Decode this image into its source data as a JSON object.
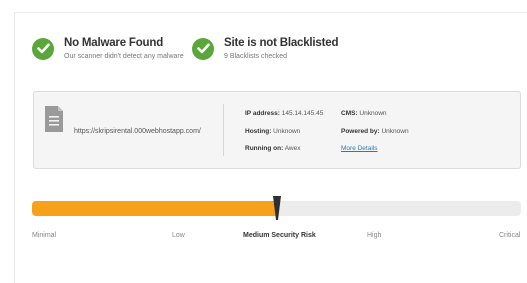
{
  "status": {
    "malware": {
      "title": "No Malware Found",
      "subtitle": "Our scanner didn't detect any malware",
      "icon": "check-circle-icon"
    },
    "blacklist": {
      "title": "Site is not Blacklisted",
      "subtitle": "9 Blacklists checked",
      "icon": "check-circle-icon"
    }
  },
  "site": {
    "url": "https://skripsirental.000webhostapp.com/",
    "icon": "document-icon",
    "ip_label": "IP address:",
    "ip_value": "145.14.145.45",
    "hosting_label": "Hosting:",
    "hosting_value": "Unknown",
    "running_label": "Running on:",
    "running_value": "Awex",
    "cms_label": "CMS:",
    "cms_value": "Unknown",
    "powered_label": "Powered by:",
    "powered_value": "Unknown",
    "details_link": "More Details"
  },
  "risk": {
    "level_fraction": 0.5,
    "labels": [
      "Minimal",
      "Low",
      "Medium Security Risk",
      "High",
      "Critical"
    ],
    "active_index": 2
  },
  "colors": {
    "check_green": "#5aa63a",
    "risk_orange": "#f7a11b",
    "link_blue": "#2a78b8"
  }
}
